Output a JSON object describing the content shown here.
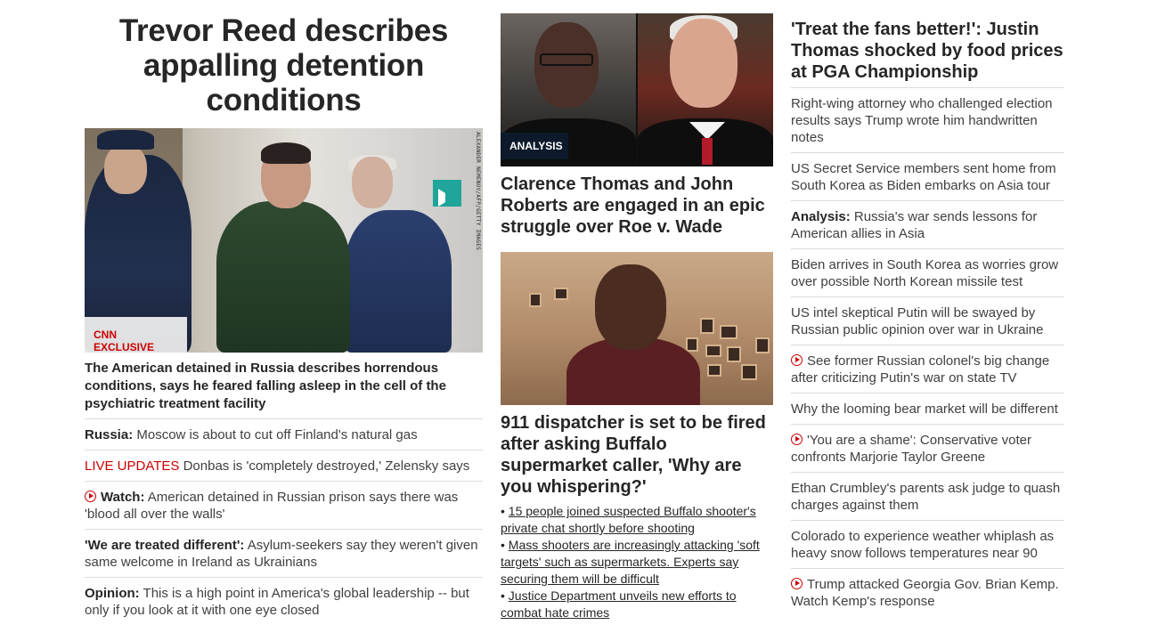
{
  "left": {
    "headline": "Trevor Reed describes appalling detention conditions",
    "image_tag": "CNN EXCLUSIVE",
    "image_credit": "ALEXANDER NEMENOV/AFP/GETTY IMAGES",
    "sub_headline": "The American detained in Russia describes horrendous conditions, says he feared falling asleep in the cell of the psychiatric treatment facility",
    "stories": [
      {
        "prefix": "Russia:",
        "text": " Moscow is about to cut off Finland's natural gas"
      },
      {
        "live": "LIVE UPDATES",
        "text": " Donbas is 'completely destroyed,' Zelensky says"
      },
      {
        "prefix": "Watch:",
        "text": " American detained in Russian prison says there was 'blood all over the walls'",
        "video": true
      },
      {
        "prefix": "'We are treated different':",
        "text": " Asylum-seekers say they weren't given same welcome in Ireland as Ukrainians"
      },
      {
        "prefix": "Opinion:",
        "text": " This is a high point in America's global leadership -- but only if you look at it with one eye closed"
      }
    ]
  },
  "middle": {
    "top_tag": "ANALYSIS",
    "top_headline": "Clarence Thomas and John Roberts are engaged in an epic struggle over Roe v. Wade",
    "second_headline": "911 dispatcher is set to be fired after asking Buffalo supermarket caller, 'Why are you whispering?'",
    "bullets": [
      "15 people joined suspected Buffalo shooter's private chat shortly before shooting",
      "Mass shooters are increasingly attacking 'soft targets' such as supermarkets. Experts say securing them will be difficult",
      "Justice Department unveils new efforts to combat hate crimes"
    ]
  },
  "right": {
    "headline": "'Treat the fans better!': Justin Thomas shocked by food prices at PGA Championship",
    "stories": [
      {
        "text": "Right-wing attorney who challenged election results says Trump wrote him handwritten notes"
      },
      {
        "text": "US Secret Service members sent home from South Korea as Biden embarks on Asia tour"
      },
      {
        "prefix": "Analysis:",
        "text": " Russia's war sends lessons for American allies in Asia"
      },
      {
        "text": "Biden arrives in South Korea as worries grow over possible North Korean missile test"
      },
      {
        "text": "US intel skeptical Putin will be swayed by Russian public opinion over war in Ukraine"
      },
      {
        "text": "See former Russian colonel's big change after criticizing Putin's war on state TV",
        "video": true
      },
      {
        "text": "Why the looming bear market will be different"
      },
      {
        "text": "'You are a shame': Conservative voter confronts Marjorie Taylor Greene",
        "video": true
      },
      {
        "text": "Ethan Crumbley's parents ask judge to quash charges against them"
      },
      {
        "text": "Colorado to experience weather whiplash as heavy snow follows temperatures near 90"
      },
      {
        "text": "Trump attacked Georgia Gov. Brian Kemp. Watch Kemp's response",
        "video": true
      }
    ]
  },
  "colors": {
    "accent_red": "#cc0000",
    "tag_dark": "#0c1a2b",
    "text": "#262626",
    "divider": "#dcdcdc"
  }
}
